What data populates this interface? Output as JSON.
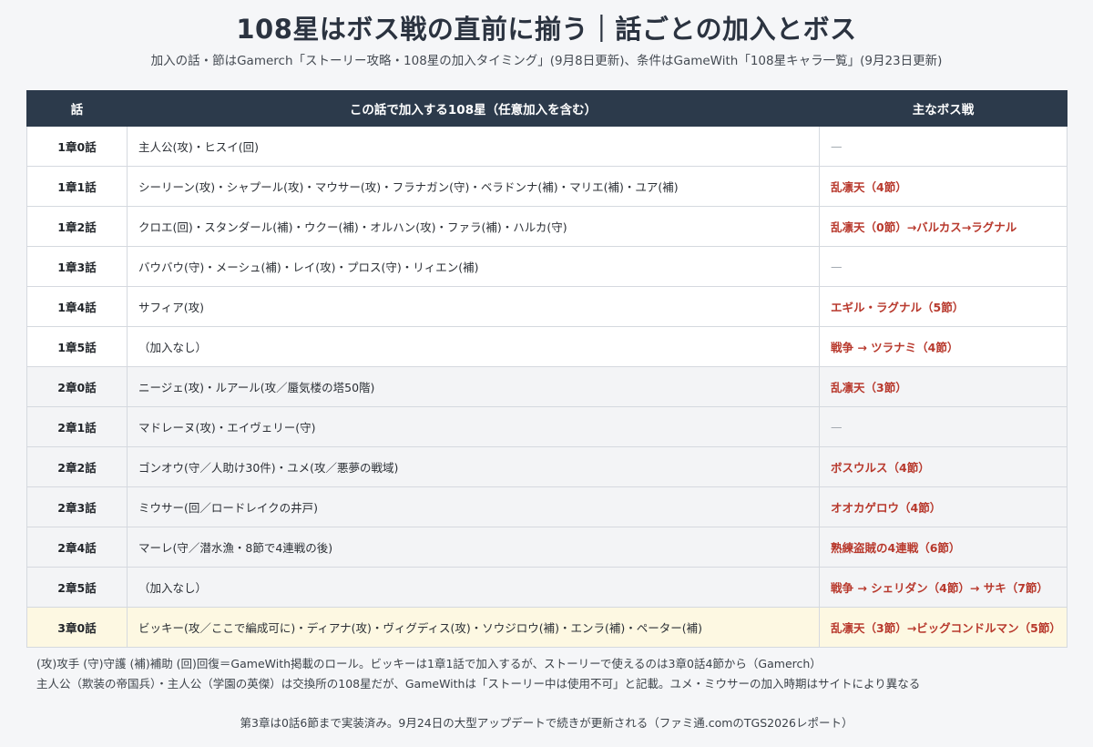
{
  "title": "108星はボス戦の直前に揃う｜話ごとの加入とボス",
  "subtitle": "加入の話・節はGamerch「ストーリー攻略・108星の加入タイミング」(9月8日更新)、条件はGameWith「108星キャラ一覧」(9月23日更新)",
  "table": {
    "headers": {
      "episode": "話",
      "members": "この話で加入する108星（任意加入を含む）",
      "boss": "主なボス戦"
    },
    "rows": [
      {
        "episode": "1章0話",
        "members": "主人公(攻)・ヒスイ(回)",
        "boss": "—",
        "has_boss": false,
        "tint": false,
        "highlight": false
      },
      {
        "episode": "1章1話",
        "members": "シーリーン(攻)・シャプール(攻)・マウサー(攻)・フラナガン(守)・ベラドンナ(補)・マリエ(補)・ユア(補)",
        "boss": "乱凛天（4節）",
        "has_boss": true,
        "tint": false,
        "highlight": false
      },
      {
        "episode": "1章2話",
        "members": "クロエ(回)・スタンダール(補)・ウクー(補)・オルハン(攻)・ファラ(補)・ハルカ(守)",
        "boss": "乱凛天（0節）→バルカス→ラグナル",
        "has_boss": true,
        "tint": false,
        "highlight": false
      },
      {
        "episode": "1章3話",
        "members": "バウバウ(守)・メーシュ(補)・レイ(攻)・プロス(守)・リィエン(補)",
        "boss": "—",
        "has_boss": false,
        "tint": false,
        "highlight": false
      },
      {
        "episode": "1章4話",
        "members": "サフィア(攻)",
        "boss": "エギル・ラグナル（5節）",
        "has_boss": true,
        "tint": false,
        "highlight": false
      },
      {
        "episode": "1章5話",
        "members": "（加入なし）",
        "boss": "戦争 → ツラナミ（4節）",
        "has_boss": true,
        "tint": false,
        "highlight": false
      },
      {
        "episode": "2章0話",
        "members": "ニージェ(攻)・ルアール(攻／蜃気楼の塔50階)",
        "boss": "乱凛天（3節）",
        "has_boss": true,
        "tint": true,
        "highlight": false
      },
      {
        "episode": "2章1話",
        "members": "マドレーヌ(攻)・エイヴェリー(守)",
        "boss": "—",
        "has_boss": false,
        "tint": true,
        "highlight": false
      },
      {
        "episode": "2章2話",
        "members": "ゴンオウ(守／人助け30件)・ユメ(攻／悪夢の戦域)",
        "boss": "ボスウルス（4節）",
        "has_boss": true,
        "tint": true,
        "highlight": false
      },
      {
        "episode": "2章3話",
        "members": "ミウサー(回／ロードレイクの井戸)",
        "boss": "オオカゲロウ（4節）",
        "has_boss": true,
        "tint": true,
        "highlight": false
      },
      {
        "episode": "2章4話",
        "members": "マーレ(守／潜水漁・8節で4連戦の後)",
        "boss": "熟練盗賊の4連戦（6節）",
        "has_boss": true,
        "tint": true,
        "highlight": false
      },
      {
        "episode": "2章5話",
        "members": "（加入なし）",
        "boss": "戦争 → シェリダン（4節）→ サキ（7節）",
        "has_boss": true,
        "tint": true,
        "highlight": false
      },
      {
        "episode": "3章0話",
        "members": "ビッキー(攻／ここで編成可に)・ディアナ(攻)・ヴィグディス(攻)・ソウジロウ(補)・エンラ(補)・ペーター(補)",
        "boss": "乱凛天（3節）→ビッグコンドルマン（5節）",
        "has_boss": true,
        "tint": false,
        "highlight": true
      }
    ]
  },
  "notes": [
    "(攻)攻手 (守)守護 (補)補助 (回)回復＝GameWith掲載のロール。ビッキーは1章1話で加入するが、ストーリーで使えるのは3章0話4節から（Gamerch）",
    "主人公（欺装の帝国兵）・主人公（学園の英傑）は交換所の108星だが、GameWithは「ストーリー中は使用不可」と記載。ユメ・ミウサーの加入時期はサイトにより異なる"
  ],
  "footer": "第3章は0話6節まで実装済み。9月24日の大型アップデートで続きが更新される（ファミ通.comのTGS2026レポート）",
  "colors": {
    "header_bg": "#2c3a4b",
    "boss_accent": "#b8392d",
    "tint_row": "#f3f4f6",
    "highlight_row": "#fdf8e2",
    "page_bg": "#f5f6f8"
  }
}
